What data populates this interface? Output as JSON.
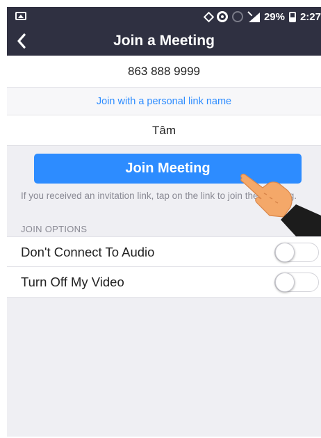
{
  "status_bar": {
    "battery": "29%",
    "time": "2:27"
  },
  "header": {
    "back_icon": "chevron-left-icon",
    "title": "Join a Meeting"
  },
  "form": {
    "meeting_id": "863 888 9999",
    "personal_link": "Join with a personal link name",
    "name": "Tâm"
  },
  "join_button": {
    "label": "Join Meeting"
  },
  "hint": "If you received an invitation link, tap on the link to join the meeting.",
  "options": {
    "header": "JOIN OPTIONS",
    "items": [
      {
        "label": "Don't Connect To Audio",
        "enabled": false
      },
      {
        "label": "Turn Off My Video",
        "enabled": false
      }
    ]
  },
  "colors": {
    "header_bg": "#2f3041",
    "accent": "#2d8cff",
    "page_bg": "#efeff3"
  }
}
